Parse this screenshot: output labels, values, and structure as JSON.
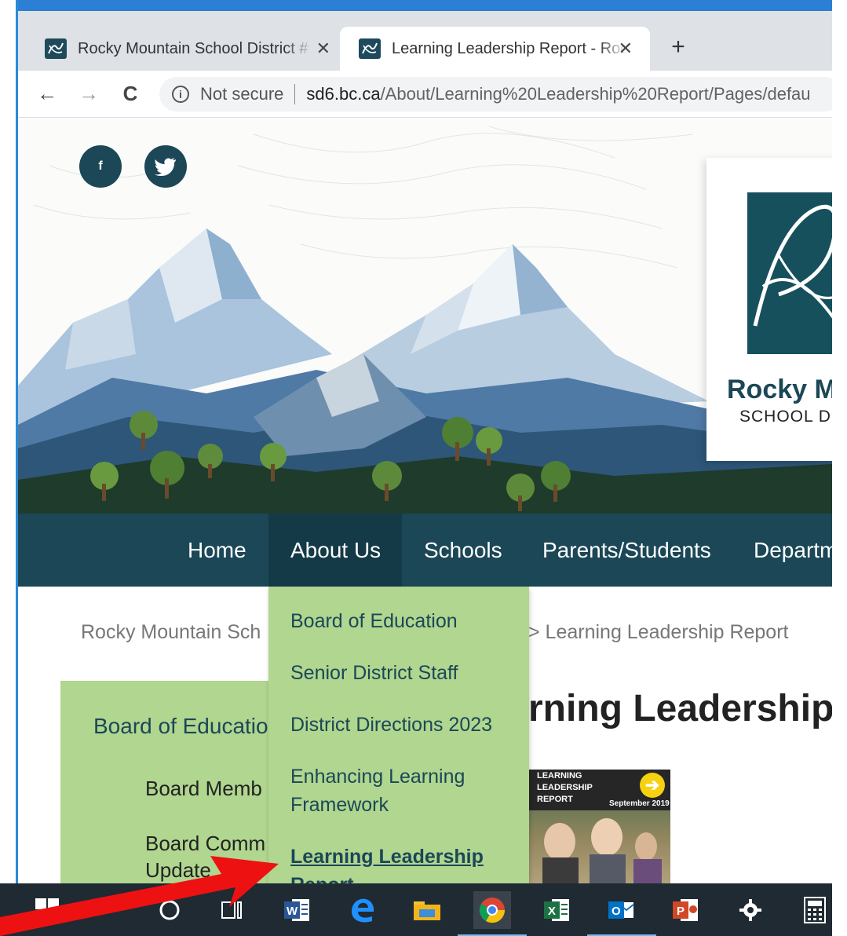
{
  "browser": {
    "tabs": [
      {
        "title": "Rocky Mountain School District #",
        "close": "✕"
      },
      {
        "title": "Learning Leadership Report - Roc",
        "close": "✕"
      }
    ],
    "new_tab": "+",
    "back": "←",
    "forward": "→",
    "reload": "C",
    "security_icon": "ⓘ",
    "security_label": "Not secure",
    "url_host": "sd6.bc.ca",
    "url_path": "/About/Learning%20Leadership%20Report/Pages/defau"
  },
  "hero": {
    "social": [
      {
        "icon": "facebook-icon",
        "glyph": "f"
      },
      {
        "icon": "twitter-icon",
        "glyph": "🐦"
      }
    ],
    "logo_name": "Rocky M",
    "logo_sub": "SCHOOL DI"
  },
  "nav": {
    "items": [
      {
        "label": "Home"
      },
      {
        "label": "About Us"
      },
      {
        "label": "Schools"
      },
      {
        "label": "Parents/Students"
      },
      {
        "label": "Departm"
      }
    ]
  },
  "dropdown": {
    "items": [
      {
        "label": "Board of Education"
      },
      {
        "label": "Senior District Staff"
      },
      {
        "label": "District Directions 2023"
      },
      {
        "label": "Enhancing Learning"
      },
      {
        "label": "Framework"
      },
      {
        "label": "Learning Leadership"
      },
      {
        "label": "Report"
      }
    ]
  },
  "breadcrumb": {
    "left": "Rocky Mountain Sch",
    "right": "> Learning Leadership Report"
  },
  "left_panel": {
    "heading": "Board of Educatio",
    "items": [
      {
        "label": "Board Memb"
      },
      {
        "label": "Board Comm"
      },
      {
        "label": "Update"
      }
    ]
  },
  "page": {
    "heading": "rning Leadership R"
  },
  "report_thumb": {
    "line1": "LEARNING",
    "line2": "LEADERSHIP",
    "line3": "REPORT",
    "date": "September 2019",
    "arrow": "➔"
  },
  "colors": {
    "nav_bg": "#1b4757",
    "dropdown_bg": "#b0d68f",
    "annotation": "#ee1111"
  },
  "taskbar": {
    "icons": [
      "start-icon",
      "cortana-icon",
      "task-view-icon",
      "word-icon",
      "edge-icon",
      "file-explorer-icon",
      "chrome-icon",
      "excel-icon",
      "outlook-icon",
      "powerpoint-icon",
      "settings-icon",
      "calculator-icon"
    ]
  }
}
